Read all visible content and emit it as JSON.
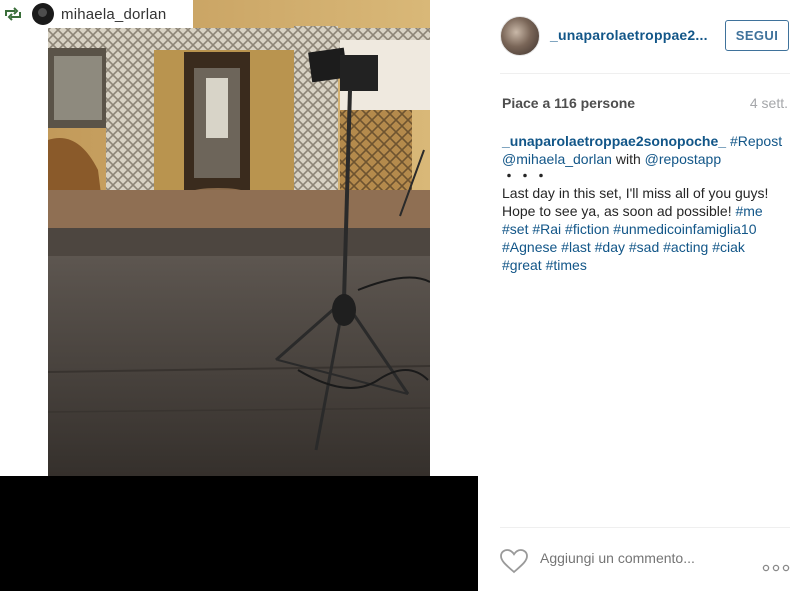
{
  "repost_badge": {
    "username": "mihaela_dorlan",
    "icon": "repost-icon"
  },
  "post": {
    "author": "_unaparolaetroppae2...",
    "follow_label": "SEGUI",
    "likes": "Piace a 116 persone",
    "time": "4 sett.",
    "caption": {
      "username": "_unaparolaetroppae2sonopoche_",
      "repost_tag": "#Repost",
      "mention": "@mihaela_dorlan",
      "with_word": "with",
      "app_mention": "@repostapp",
      "dots": "・・・",
      "text": "Last day in this set, I'll miss all of you guys! Hope to see ya, as soon ad possible!",
      "hashtags": [
        "#me",
        "#set",
        "#Rai",
        "#fiction",
        "#unmedicoinfamiglia10",
        "#Agnese",
        "#last",
        "#day",
        "#sad",
        "#acting",
        "#ciak",
        "#great",
        "#times"
      ]
    },
    "comment_placeholder": "Aggiungi un commento...",
    "icons": [
      "heart-icon",
      "more-options-icon"
    ]
  },
  "colors": {
    "link": "#125688",
    "button": "#3f729b",
    "muted": "#a5a7aa",
    "divider": "#efefef"
  }
}
